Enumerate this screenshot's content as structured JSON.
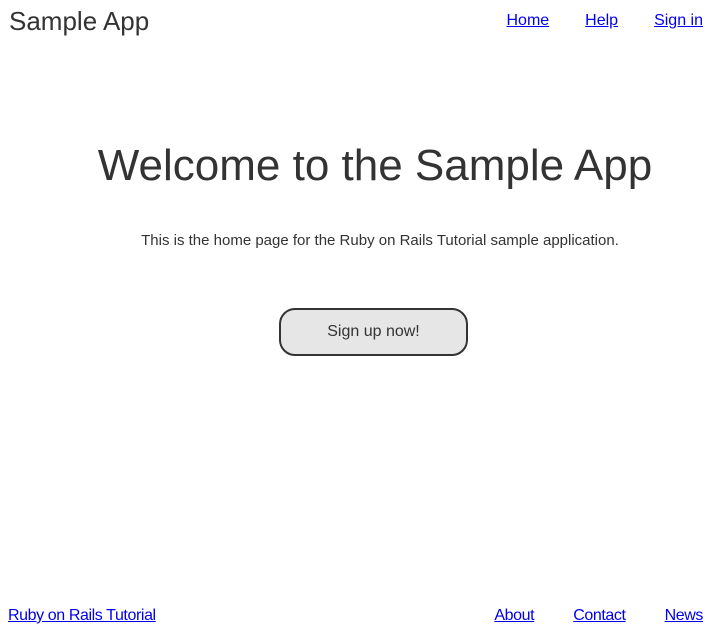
{
  "header": {
    "logo": "Sample App",
    "nav": [
      {
        "label": "Home"
      },
      {
        "label": "Help"
      },
      {
        "label": "Sign in"
      }
    ]
  },
  "hero": {
    "title": "Welcome to the Sample App",
    "subtitle": "This is the home page for the Ruby on Rails Tutorial sample application.",
    "signup_label": "Sign up now!"
  },
  "footer": {
    "left_link": "Ruby on Rails Tutorial",
    "links": [
      {
        "label": "About"
      },
      {
        "label": "Contact"
      },
      {
        "label": "News"
      }
    ]
  },
  "colors": {
    "text": "#333333",
    "link": "#0000ee",
    "button_bg": "#e6e6e6",
    "button_border": "#333333",
    "background": "#ffffff"
  }
}
